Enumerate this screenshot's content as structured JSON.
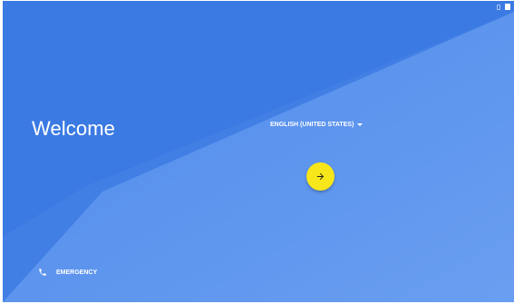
{
  "welcome": {
    "title": "Welcome"
  },
  "language": {
    "selected": "ENGLISH (UNITED STATES)",
    "dropdown_icon": "arrow-drop-down-icon"
  },
  "next_button": {
    "icon": "arrow-right-icon",
    "color": "#f6e61a"
  },
  "emergency": {
    "label": "EMERGENCY",
    "icon": "phone-icon"
  },
  "status_bar": {
    "icons": [
      "notification-icon",
      "battery-icon"
    ]
  },
  "colors": {
    "background_dark": "#3b79e3",
    "background_light": "#6a9ef0",
    "accent": "#f6e61a",
    "text": "#ffffff"
  }
}
